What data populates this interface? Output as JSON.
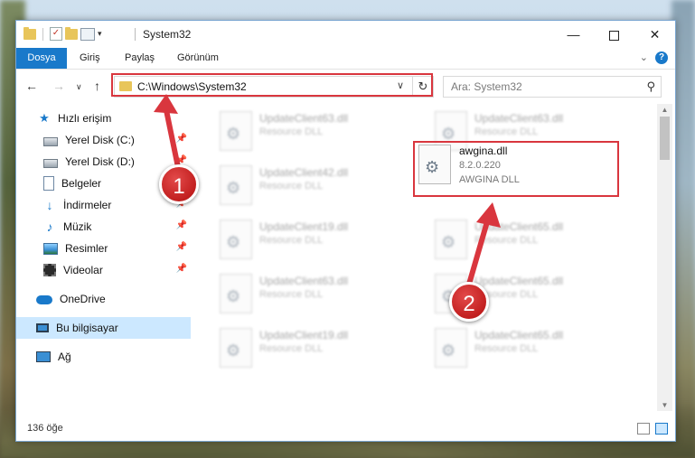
{
  "window": {
    "title": "System32",
    "controls": {
      "minimize": "—",
      "maximize": "",
      "close": "✕"
    }
  },
  "ribbon": {
    "tabs": [
      "Dosya",
      "Giriş",
      "Paylaş",
      "Görünüm"
    ],
    "expand": "⌄",
    "help": "?"
  },
  "address": {
    "path": "C:\\Windows\\System32",
    "search_placeholder": "Ara: System32"
  },
  "sidebar": {
    "quick_access": "Hızlı erişim",
    "items": [
      {
        "label": "Yerel Disk (C:)",
        "icon": "disk-icon",
        "pinned": true
      },
      {
        "label": "Yerel Disk (D:)",
        "icon": "disk-icon",
        "pinned": true
      },
      {
        "label": "Belgeler",
        "icon": "documents-icon",
        "pinned": true
      },
      {
        "label": "İndirmeler",
        "icon": "downloads-icon",
        "pinned": true
      },
      {
        "label": "Müzik",
        "icon": "music-icon",
        "pinned": true
      },
      {
        "label": "Resimler",
        "icon": "pictures-icon",
        "pinned": true
      },
      {
        "label": "Videolar",
        "icon": "videos-icon",
        "pinned": true
      }
    ],
    "onedrive": "OneDrive",
    "this_pc": "Bu bilgisayar",
    "network": "Ağ"
  },
  "files": [
    {
      "name": "UpdateClient63.dll",
      "desc": "Resource DLL"
    },
    {
      "name": "UpdateClient63.dll",
      "desc": "Resource DLL"
    },
    {
      "name": "UpdateClient42.dll",
      "desc": "Resource DLL"
    },
    {
      "name": "UpdateClient19.dll",
      "desc": "Resource DLL"
    },
    {
      "name": "UpdateClient65.dll",
      "desc": "Resource DLL"
    },
    {
      "name": "UpdateClient63.dll",
      "desc": "Resource DLL"
    },
    {
      "name": "UpdateClient65.dll",
      "desc": "Resource DLL"
    },
    {
      "name": "UpdateClient19.dll",
      "desc": "Resource DLL"
    },
    {
      "name": "UpdateClient65.dll",
      "desc": "Resource DLL"
    }
  ],
  "highlighted_file": {
    "name": "awgina.dll",
    "version": "8.2.0.220",
    "desc": "AWGINA  DLL"
  },
  "status": {
    "count": "136 öğe"
  },
  "markers": {
    "one": "1",
    "two": "2"
  },
  "colors": {
    "accent": "#1979ca",
    "annotation": "#d9363e"
  }
}
